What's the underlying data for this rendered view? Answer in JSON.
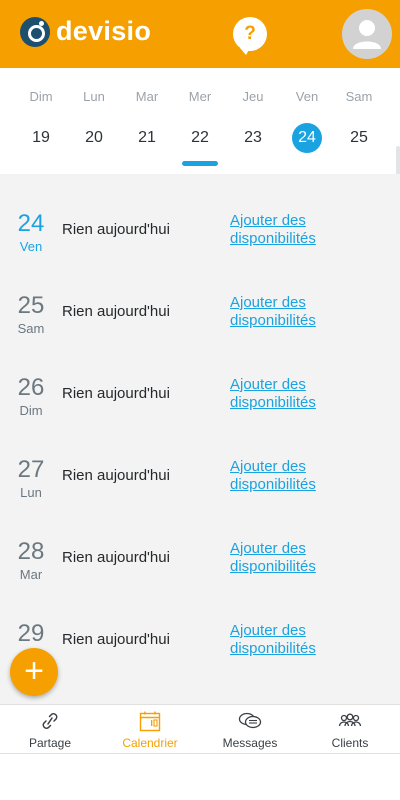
{
  "header": {
    "brand": "devisio",
    "help_label": "?",
    "colors": {
      "primary": "#f5a000",
      "accent": "#1aa3e0"
    }
  },
  "week": {
    "days": [
      {
        "name": "Dim",
        "num": "19"
      },
      {
        "name": "Lun",
        "num": "20"
      },
      {
        "name": "Mar",
        "num": "21"
      },
      {
        "name": "Mer",
        "num": "22"
      },
      {
        "name": "Jeu",
        "num": "23"
      },
      {
        "name": "Ven",
        "num": "24",
        "selected": true
      },
      {
        "name": "Sam",
        "num": "25"
      }
    ]
  },
  "agenda": [
    {
      "num": "24",
      "day": "Ven",
      "text": "Rien aujourd'hui",
      "link": "Ajouter des disponibilités",
      "today": true
    },
    {
      "num": "25",
      "day": "Sam",
      "text": "Rien aujourd'hui",
      "link": "Ajouter des disponibilités"
    },
    {
      "num": "26",
      "day": "Dim",
      "text": "Rien aujourd'hui",
      "link": "Ajouter des disponibilités"
    },
    {
      "num": "27",
      "day": "Lun",
      "text": "Rien aujourd'hui",
      "link": "Ajouter des disponibilités"
    },
    {
      "num": "28",
      "day": "Mar",
      "text": "Rien aujourd'hui",
      "link": "Ajouter des disponibilités"
    },
    {
      "num": "29",
      "day": "",
      "text": "Rien aujourd'hui",
      "link": "Ajouter des disponibilités"
    }
  ],
  "fab": {
    "label": "+"
  },
  "nav": {
    "items": [
      {
        "label": "Partage",
        "icon": "link-icon"
      },
      {
        "label": "Calendrier",
        "icon": "calendar-icon",
        "active": true
      },
      {
        "label": "Messages",
        "icon": "chat-icon"
      },
      {
        "label": "Clients",
        "icon": "users-icon"
      }
    ]
  }
}
